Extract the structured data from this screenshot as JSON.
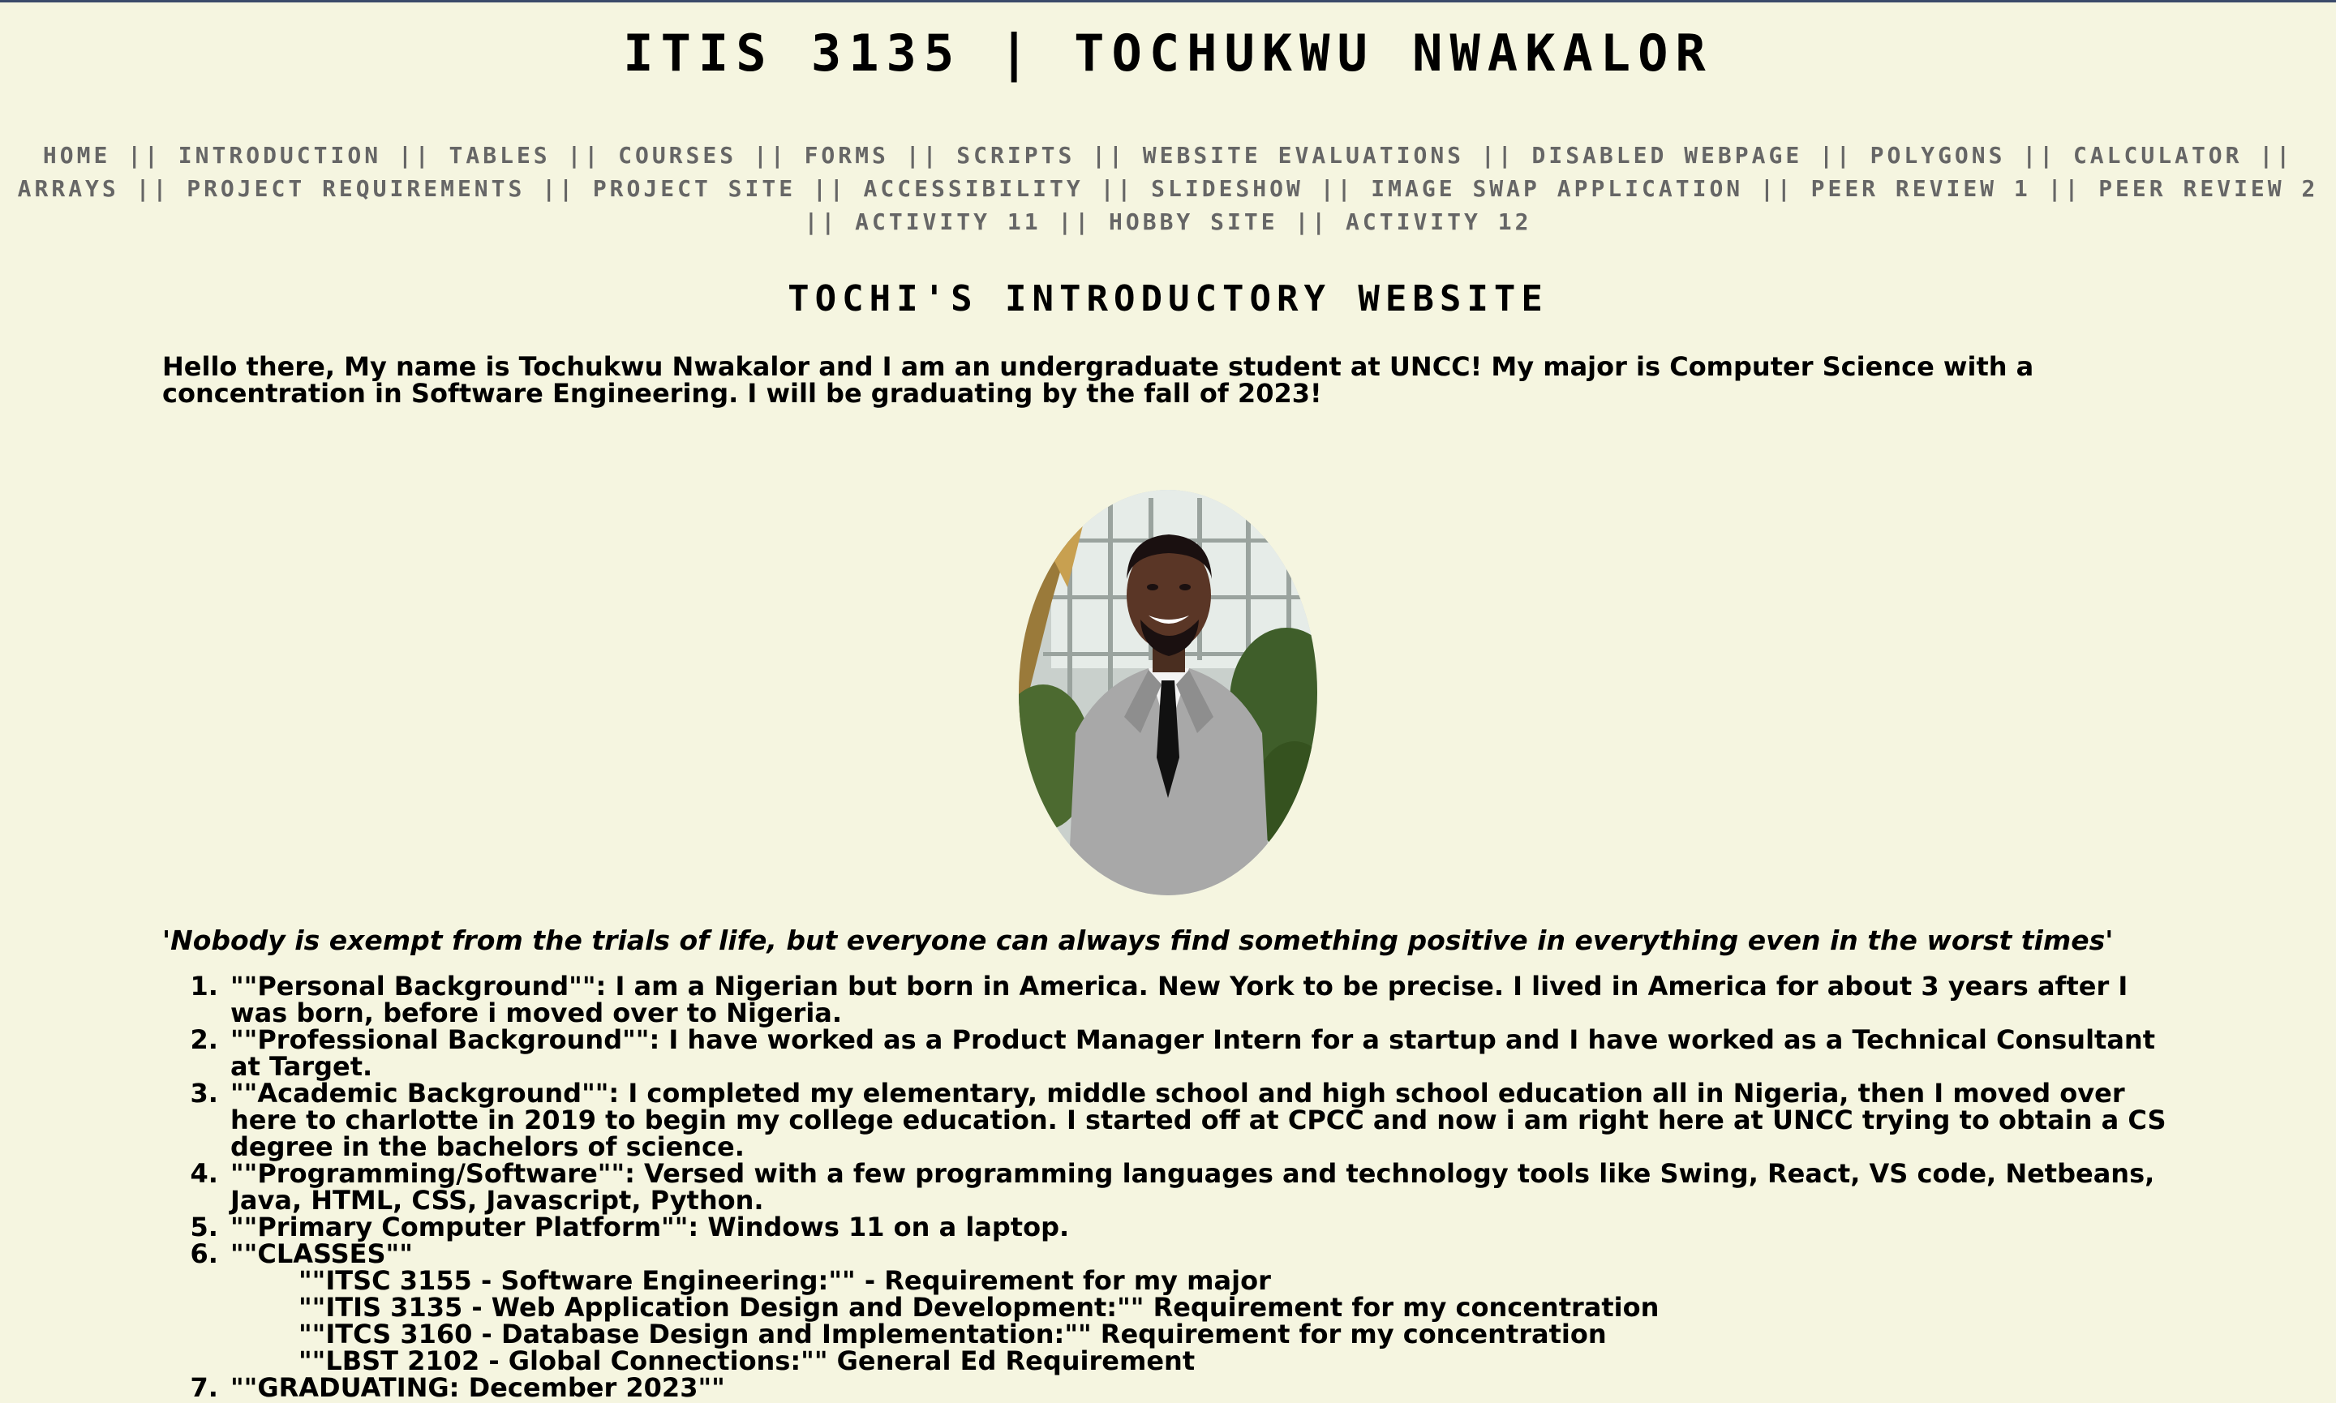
{
  "header": {
    "title": "ITIS 3135 | TOCHUKWU NWAKALOR"
  },
  "nav": {
    "separator": "||",
    "items": [
      "HOME",
      "INTRODUCTION",
      "TABLES",
      "COURSES",
      "FORMS",
      "SCRIPTS",
      "WEBSITE EVALUATIONS",
      "DISABLED WEBPAGE",
      "POLYGONS",
      "CALCULATOR",
      "ARRAYS",
      "PROJECT REQUIREMENTS",
      "PROJECT SITE",
      "ACCESSIBILITY",
      "SLIDESHOW",
      "IMAGE SWAP APPLICATION",
      "PEER REVIEW 1",
      "PEER REVIEW 2",
      "ACTIVITY 11",
      "HOBBY SITE",
      "ACTIVITY 12"
    ]
  },
  "main": {
    "heading": "TOCHI'S INTRODUCTORY WEBSITE",
    "intro": "Hello there, My name is Tochukwu Nwakalor and I am an undergraduate student at UNCC! My major is Computer Science with a concentration in Software Engineering. I will be graduating by the fall of 2023!",
    "quote": "'Nobody is exempt from the trials of life, but everyone can always find something positive in everything even in the worst times'",
    "list": [
      "\"\"Personal Background\"\": I am a Nigerian but born in America. New York to be precise. I lived in America for about 3 years after I was born, before i moved over to Nigeria.",
      "\"\"Professional Background\"\": I have worked as a Product Manager Intern for a startup and I have worked as a Technical Consultant at Target.",
      "\"\"Academic Background\"\": I completed my elementary, middle school and high school education all in Nigeria, then I moved over here to charlotte in 2019 to begin my college education. I started off at CPCC and now i am right here at UNCC trying to obtain a CS degree in the bachelors of science.",
      "\"\"Programming/Software\"\": Versed with a few programming languages and technology tools like Swing, React, VS code, Netbeans, Java, HTML, CSS, Javascript, Python.",
      "\"\"Primary Computer Platform\"\": Windows 11 on a laptop.",
      "\"\"CLASSES\"\"",
      "\"\"GRADUATING: December 2023\"\""
    ],
    "classes": [
      "\"\"ITSC 3155 - Software Engineering:\"\" - Requirement for my major",
      "\"\"ITIS 3135 - Web Application Design and Development:\"\" Requirement for my concentration",
      "\"\"ITCS 3160 - Database Design and Implementation:\"\" Requirement for my concentration",
      "\"\"LBST 2102 - Global Connections:\"\" General Ed Requirement"
    ]
  }
}
